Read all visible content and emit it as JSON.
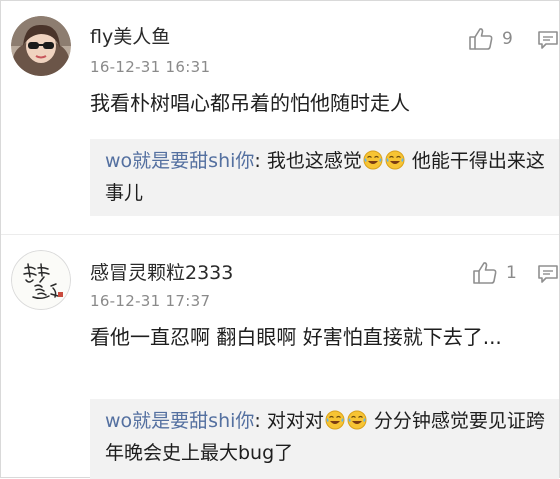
{
  "comments": [
    {
      "username": "fly美人鱼",
      "time": "16-12-31 16:31",
      "likes": "9",
      "content": "我看朴树唱心都吊着的怕他随时走人",
      "reply": {
        "user": "wo就是要甜shi你",
        "separator": ": ",
        "text_before": "我也这感觉",
        "text_after": " 他能干得出来这事儿"
      }
    },
    {
      "username": "感冒灵颗粒2333",
      "time": "16-12-31 17:37",
      "likes": "1",
      "content": "看他一直忍啊 翻白眼啊 好害怕直接就下去了...",
      "avatar_text": "春生 幸福",
      "reply": {
        "user": "wo就是要甜shi你",
        "separator": ": ",
        "text_before": "对对对",
        "text_after": " 分分钟感觉要见证跨年晚会史上最大bug了"
      }
    }
  ],
  "icons": {
    "like": "thumbs-up-icon",
    "reply": "comment-icon",
    "emoji": "laugh-cry-emoji"
  },
  "colors": {
    "reply_user": "#5470a0",
    "reply_bg": "#f2f2f2",
    "meta": "#8a8a8a"
  }
}
